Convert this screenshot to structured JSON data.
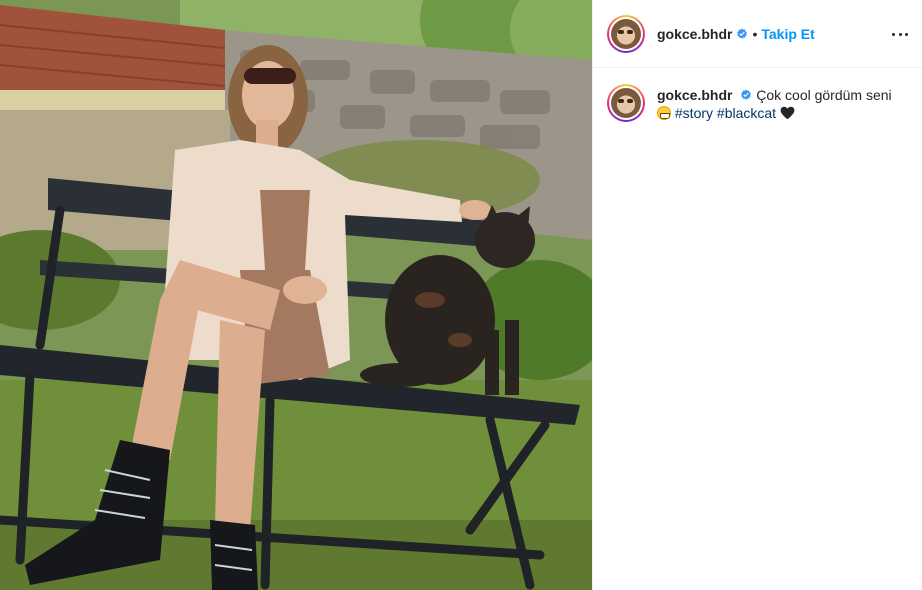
{
  "post": {
    "username": "gokce.bhdr",
    "follow_label": "Takip Et",
    "separator": "•",
    "caption_text": "Çok cool gördüm seni",
    "hashtags": [
      "#story",
      "#blackcat"
    ]
  },
  "icons": {
    "verified": "verified-badge-icon",
    "more": "more-options-icon",
    "emoji": "grinning-face-emoji-icon",
    "heart": "black-heart-icon"
  },
  "colors": {
    "accent": "#0095f6",
    "verified": "#3897f0",
    "hashtag": "#00376b",
    "text": "#262626",
    "border": "#efefef"
  }
}
